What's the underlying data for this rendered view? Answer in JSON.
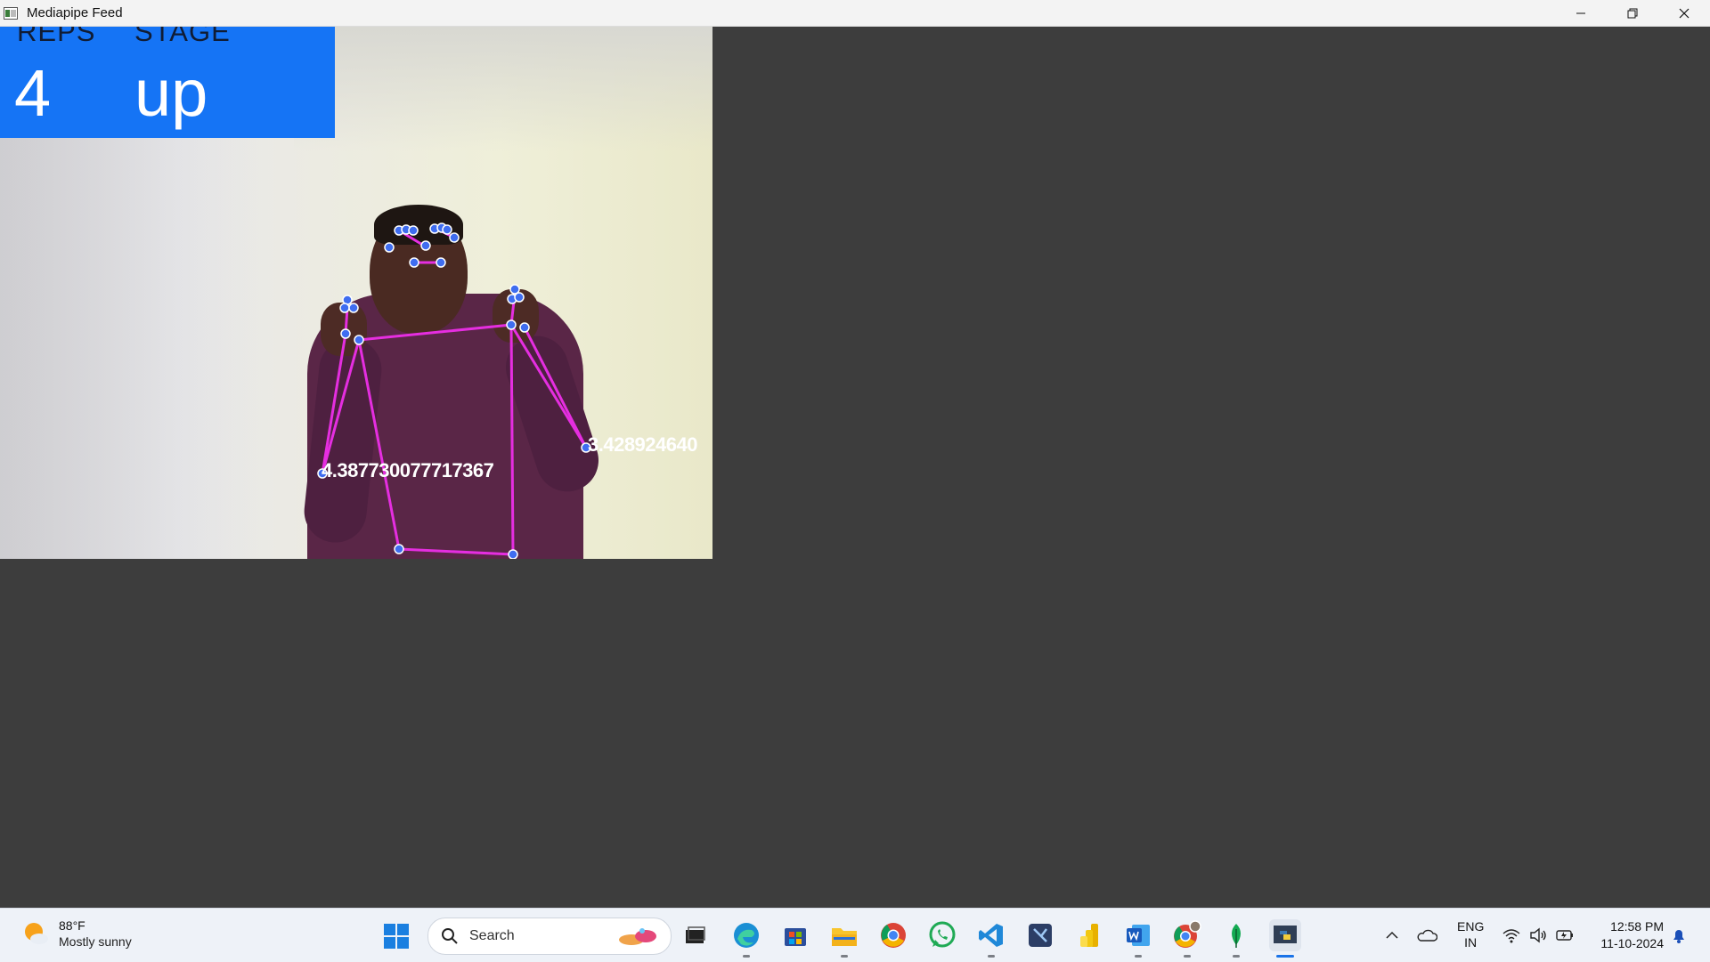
{
  "window": {
    "title": "Mediapipe Feed"
  },
  "hud": {
    "reps_label": "REPS",
    "stage_label": "STAGE",
    "reps_value": "4",
    "stage_value": "up",
    "background_color": "#1574f5"
  },
  "pose_overlay": {
    "left_angle_label": "4.387730077717367",
    "right_angle_label": "3.428924640",
    "line_color": "#e52ee0",
    "landmark_color": "#3f6df0"
  },
  "taskbar": {
    "weather": {
      "temperature": "88°F",
      "condition": "Mostly sunny",
      "icon": "sun-cloud-icon"
    },
    "search_placeholder": "Search",
    "pinned_apps": [
      {
        "name": "task-view",
        "icon": "task-view-icon"
      },
      {
        "name": "edge",
        "icon": "edge-icon"
      },
      {
        "name": "microsoft-store",
        "icon": "store-icon"
      },
      {
        "name": "file-explorer",
        "icon": "folder-icon"
      },
      {
        "name": "chrome",
        "icon": "chrome-icon"
      },
      {
        "name": "whatsapp",
        "icon": "whatsapp-icon"
      },
      {
        "name": "vscode",
        "icon": "vscode-icon"
      },
      {
        "name": "snipping-tool",
        "icon": "snip-icon"
      },
      {
        "name": "power-bi",
        "icon": "powerbi-icon"
      },
      {
        "name": "word",
        "icon": "word-icon"
      },
      {
        "name": "chrome-profile",
        "icon": "chrome-profile-icon"
      },
      {
        "name": "mongodb-compass",
        "icon": "leaf-icon"
      },
      {
        "name": "python",
        "icon": "python-icon"
      }
    ],
    "tray": {
      "language_line1": "ENG",
      "language_line2": "IN",
      "time": "12:58 PM",
      "date": "11-10-2024"
    }
  }
}
